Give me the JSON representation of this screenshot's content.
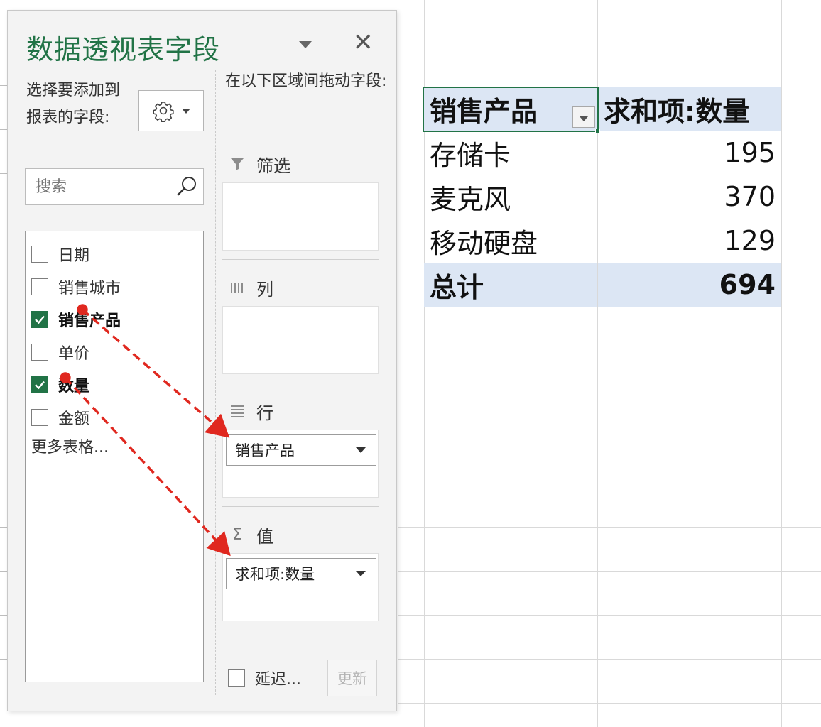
{
  "pane": {
    "title": "数据透视表字段",
    "choose_label": "选择要添加到报表的字段:",
    "search_placeholder": "搜索",
    "fields": [
      {
        "label": "日期",
        "checked": false
      },
      {
        "label": "销售城市",
        "checked": false
      },
      {
        "label": "销售产品",
        "checked": true
      },
      {
        "label": "单价",
        "checked": false
      },
      {
        "label": "数量",
        "checked": true
      },
      {
        "label": "金额",
        "checked": false
      }
    ],
    "more_tables": "更多表格...",
    "drag_label": "在以下区域间拖动字段:",
    "areas": {
      "filter": {
        "label": "筛选"
      },
      "columns": {
        "label": "列"
      },
      "rows": {
        "label": "行",
        "item": "销售产品"
      },
      "values": {
        "label": "值",
        "item": "求和项:数量"
      }
    },
    "defer_label": "延迟...",
    "update_label": "更新",
    "icons": [
      "gear-icon",
      "search-icon",
      "close-icon",
      "filter-icon",
      "columns-icon",
      "rows-icon",
      "sigma-icon"
    ]
  },
  "pivot": {
    "header": {
      "row_label": "销售产品",
      "value_label": "求和项:数量"
    },
    "rows": [
      {
        "label": "存储卡",
        "value": "195"
      },
      {
        "label": "麦克风",
        "value": "370"
      },
      {
        "label": "移动硬盘",
        "value": "129"
      }
    ],
    "total": {
      "label": "总计",
      "value": "694"
    }
  },
  "colors": {
    "accent": "#217346",
    "pivot_header_bg": "#dce6f4",
    "annotation_arrow": "#e0281f"
  }
}
